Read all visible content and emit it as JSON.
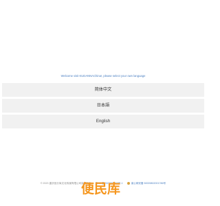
{
  "welcome_text": "Welcome visit KUDANNAChina!, please select your own language",
  "languages": [
    {
      "label": "简体中文"
    },
    {
      "label": "日本語"
    },
    {
      "label": "English"
    }
  ],
  "footer": {
    "copyright": "© 2023 重庆依分库文化传媒有限公司版权所有",
    "icp": "渝ICP备2023000468号-1",
    "police_record": "渝公网安备 50009802001786号"
  },
  "brand": {
    "logo_text": "便民库",
    "color": "#f5961e"
  },
  "colors": {
    "link": "#4a7fc1",
    "button_bg": "#f1f1f1"
  }
}
